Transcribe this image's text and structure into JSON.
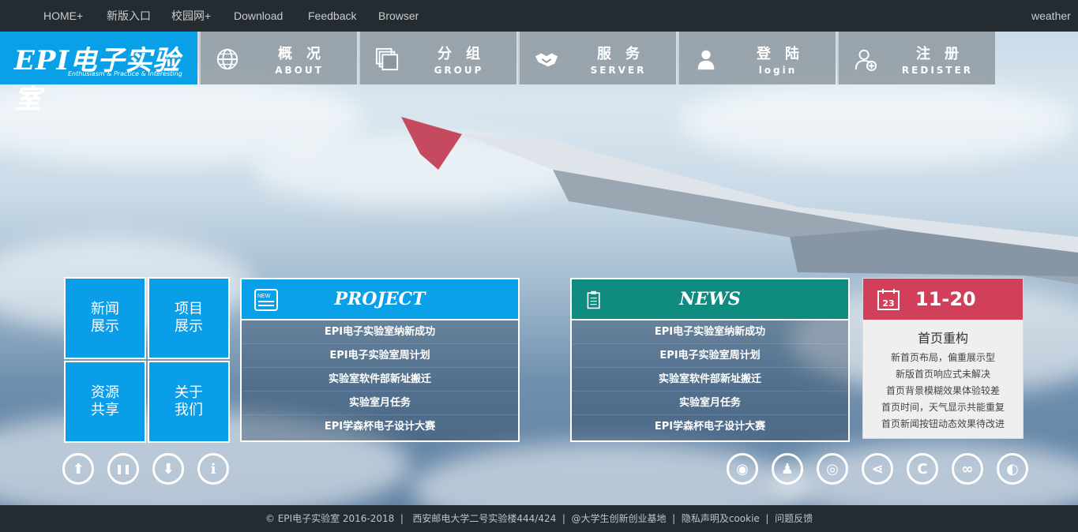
{
  "topnav": {
    "items": [
      "HOME+",
      "新版入口",
      "校园网+",
      "Download",
      "Feedback",
      "Browser"
    ],
    "weather": "weather"
  },
  "logo": {
    "title": "EPI电子实验室",
    "tagline": "Enthusiasm & Practice & Interesting",
    "brand_color": "#0aa0e8"
  },
  "nav": [
    {
      "cn": "概况",
      "en": "ABOUT",
      "icon": "globe-icon"
    },
    {
      "cn": "分组",
      "en": "GROUP",
      "icon": "layers-icon"
    },
    {
      "cn": "服务",
      "en": "SERVER",
      "icon": "handshake-icon"
    },
    {
      "cn": "登陆",
      "en": "login",
      "icon": "user-icon"
    },
    {
      "cn": "注册",
      "en": "REDISTER",
      "icon": "add-user-icon"
    }
  ],
  "tiles": [
    {
      "label": "新闻展示"
    },
    {
      "label": "项目展示"
    },
    {
      "label": "资源共享"
    },
    {
      "label": "关于我们"
    }
  ],
  "project": {
    "title": "PROJECT",
    "icon": "new-badge-icon",
    "items": [
      "EPI电子实验室纳新成功",
      "EPI电子实验室周计划",
      "实验室软件部新址搬迁",
      "实验室月任务",
      "EPI学森杯电子设计大赛"
    ]
  },
  "news": {
    "title": "NEWS",
    "icon": "clipboard-icon",
    "items": [
      "EPI电子实验室纳新成功",
      "EPI电子实验室周计划",
      "实验室软件部新址搬迁",
      "实验室月任务",
      "EPI学森杯电子设计大赛"
    ]
  },
  "datecard": {
    "date": "11-20",
    "calendar_day": "23",
    "title": "首页重构",
    "lines": [
      "新首页布局，偏重展示型",
      "新版首页响应式未解决",
      "首页背景模糊效果体验较差",
      "首页时间，天气显示共能重复",
      "首页新闻按钮动态效果待改进"
    ]
  },
  "controls": [
    {
      "icon": "arrow-up-icon",
      "glyph": "⬆"
    },
    {
      "icon": "pause-icon",
      "glyph": "❚❚"
    },
    {
      "icon": "arrow-down-icon",
      "glyph": "⬇"
    },
    {
      "icon": "info-icon",
      "glyph": "i"
    }
  ],
  "social": [
    {
      "icon": "wechat-icon",
      "glyph": "◉"
    },
    {
      "icon": "qq-icon",
      "glyph": "♟"
    },
    {
      "icon": "weibo-icon",
      "glyph": "◎"
    },
    {
      "icon": "share-icon",
      "glyph": "⋖"
    },
    {
      "icon": "c-logo-icon",
      "glyph": "C"
    },
    {
      "icon": "chain-icon",
      "glyph": "∞"
    },
    {
      "icon": "github-icon",
      "glyph": "◐"
    }
  ],
  "footer": {
    "text": "© EPI电子实验室 2016-2018  |   西安邮电大学二号实验楼444/424  |  @大学生创新创业基地  |  隐私声明及cookie  |  问题反馈"
  },
  "colors": {
    "project_head": "#0aa0e8",
    "news_head": "#0f8b80",
    "date_head": "#d23f5b",
    "bar": "#252c31"
  }
}
